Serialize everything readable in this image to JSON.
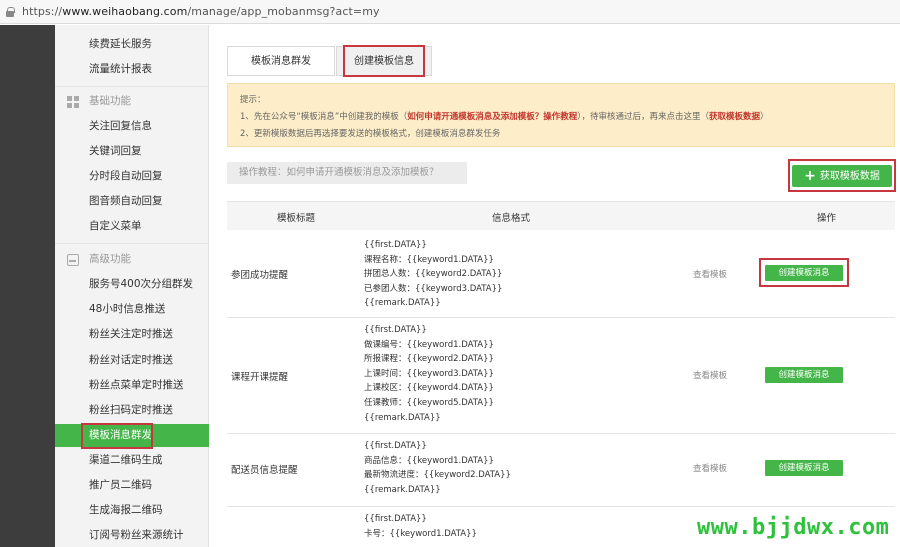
{
  "browser": {
    "url_prefix": "https://",
    "url_host": "www.weihaobang.com",
    "url_path": "/manage/app_mobanmsg?act=my"
  },
  "sidebar": {
    "top_items": [
      {
        "label": "续费延长服务"
      },
      {
        "label": "流量统计报表"
      }
    ],
    "basic_section": "基础功能",
    "basic_items": [
      {
        "label": "关注回复信息"
      },
      {
        "label": "关键词回复"
      },
      {
        "label": "分时段自动回复"
      },
      {
        "label": "图音频自动回复"
      },
      {
        "label": "自定义菜单"
      }
    ],
    "advanced_section": "高级功能",
    "advanced_items": [
      {
        "label": "服务号400次分组群发"
      },
      {
        "label": "48小时信息推送"
      },
      {
        "label": "粉丝关注定时推送"
      },
      {
        "label": "粉丝对话定时推送"
      },
      {
        "label": "粉丝点菜单定时推送"
      },
      {
        "label": "粉丝扫码定时推送"
      },
      {
        "label": "模板消息群发"
      },
      {
        "label": "渠道二维码生成"
      },
      {
        "label": "推广员二维码"
      },
      {
        "label": "生成海报二维码"
      },
      {
        "label": "订阅号粉丝来源统计"
      }
    ]
  },
  "tabs": {
    "tab1": "模板消息群发",
    "tab2": "创建模板信息"
  },
  "notice": {
    "heading": "提示：",
    "line1_a": "1、先在公众号“模板消息”中创建我的模板（",
    "line1_link": "如何申请开通模板消息及添加模板？操作教程",
    "line1_b": "），待审核通过后，再来点击这里（",
    "line1_link2": "获取模板数据",
    "line1_c": "）",
    "line2": "2、更新模版数据后再选择要发送的模板格式，创建模板消息群发任务"
  },
  "tutorial": "操作教程：如何申请开通模板消息及添加模板？",
  "fetch_button": "获取模板数据",
  "table": {
    "headers": [
      "模板标题",
      "信息格式",
      "操作"
    ],
    "view_label": "查看模板",
    "create_label": "创建模板消息",
    "rows": [
      {
        "title": "参团成功提醒",
        "format": [
          "{{first.DATA}}",
          "课程名称：{{keyword1.DATA}}",
          "拼团总人数：{{keyword2.DATA}}",
          "已参团人数：{{keyword3.DATA}}",
          "{{remark.DATA}}"
        ]
      },
      {
        "title": "课程开课提醒",
        "format": [
          "{{first.DATA}}",
          "做课编号：{{keyword1.DATA}}",
          "所报课程：{{keyword2.DATA}}",
          "上课时间：{{keyword3.DATA}}",
          "上课校区：{{keyword4.DATA}}",
          "任课教师：{{keyword5.DATA}}",
          "{{remark.DATA}}"
        ]
      },
      {
        "title": "配送员信息提醒",
        "format": [
          "{{first.DATA}}",
          "商品信息：{{keyword1.DATA}}",
          "最新物流进度：{{keyword2.DATA}}",
          "{{remark.DATA}}"
        ]
      },
      {
        "title": "",
        "format": [
          "{{first.DATA}}",
          "卡号：{{keyword1.DATA}}"
        ]
      }
    ]
  },
  "watermark": "www.bjjdwx.com",
  "colors": {
    "accent_green": "#44b549",
    "highlight_red": "#c7373f",
    "notice_bg": "#fdedc8",
    "watermark_green": "#2ec13c"
  }
}
